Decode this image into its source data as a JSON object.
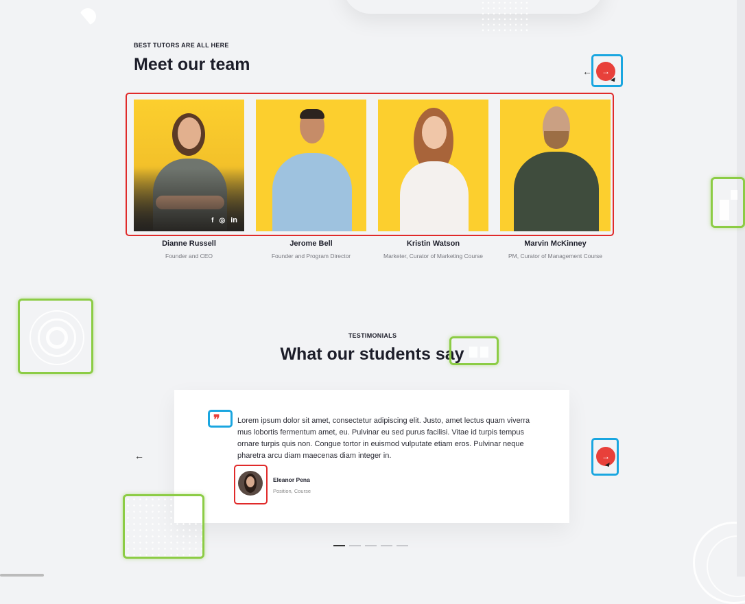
{
  "team": {
    "eyebrow": "BEST TUTORS ARE ALL HERE",
    "title": "Meet our team",
    "prev_icon": "arrow-left-icon",
    "next_icon": "arrow-right-icon",
    "members": [
      {
        "name": "Dianne Russell",
        "role": "Founder and CEO"
      },
      {
        "name": "Jerome Bell",
        "role": "Founder and Program Director"
      },
      {
        "name": "Kristin Watson",
        "role": "Marketer, Curator of Marketing Course"
      },
      {
        "name": "Marvin McKinney",
        "role": "PM, Curator of Management Course"
      }
    ],
    "socials": {
      "facebook": "f",
      "instagram": "◎",
      "linkedin": "in"
    }
  },
  "testimonials": {
    "eyebrow": "TESTIMONIALS",
    "title": "What our students say",
    "quote_mark": "❜❜",
    "text": "Lorem ipsum dolor sit amet, consectetur adipiscing elit. Justo, amet lectus quam viverra mus lobortis fermentum amet, eu. Pulvinar eu sed purus facilisi. Vitae id turpis tempus ornare turpis quis non. Congue tortor in euismod vulputate etiam eros. Pulvinar neque pharetra arcu diam maecenas diam integer in.",
    "author": "Eleanor Pena",
    "author_role": "Position, Course",
    "prev_arrow": "←",
    "next_arrow": "→",
    "pager_count": 5,
    "pager_active": 1
  },
  "colors": {
    "accent": "#e8403a",
    "card_bg": "#fccf2e",
    "page_bg": "#f2f3f5"
  }
}
